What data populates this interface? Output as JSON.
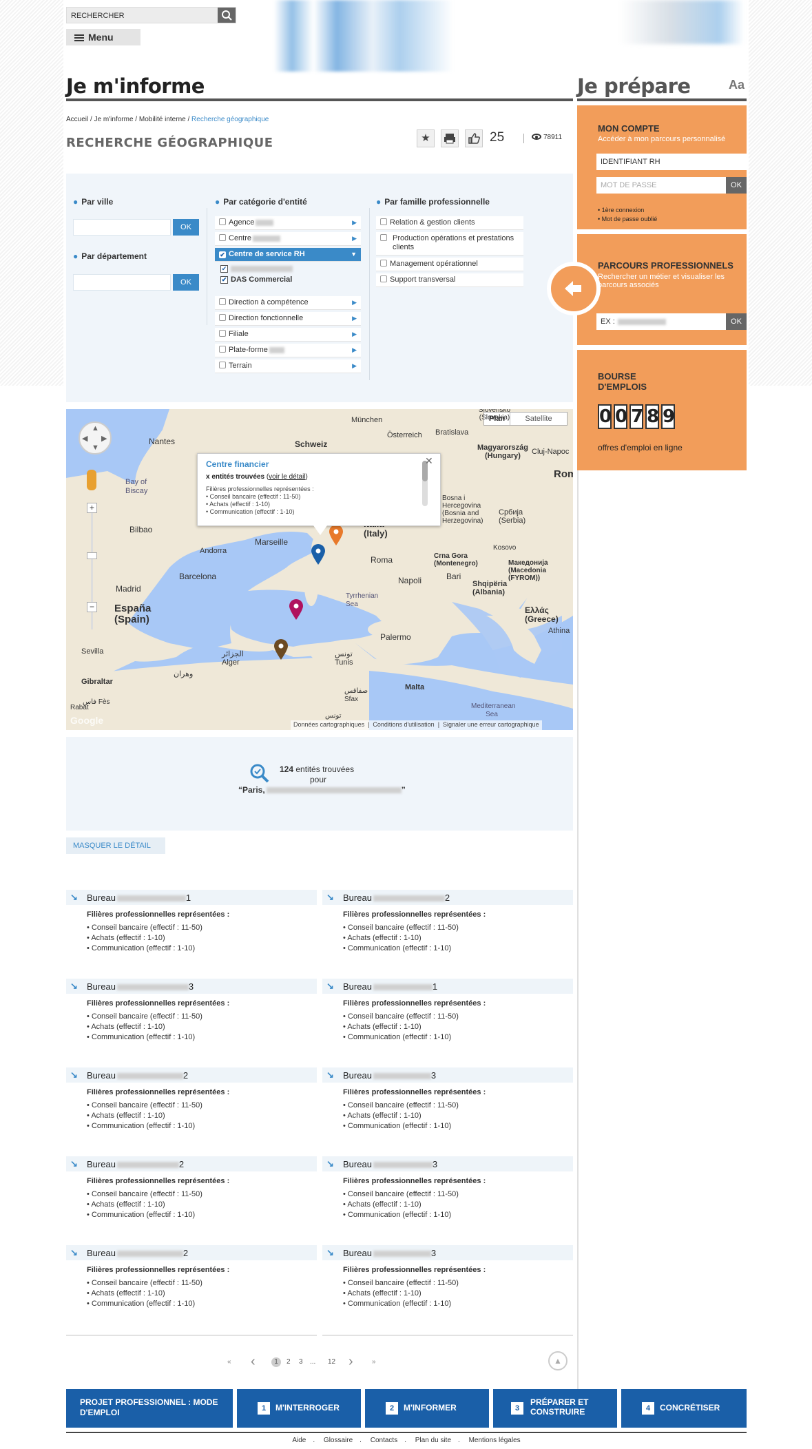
{
  "header": {
    "search_label": "RECHERCHER",
    "menu_label": "Menu",
    "section_left": "Je m'informe",
    "section_right": "Je prépare",
    "font_size_label": "Aa"
  },
  "breadcrumb": {
    "items": [
      "Accueil",
      "Je m'informe",
      "Mobilité interne"
    ],
    "current": "Recherche géographique"
  },
  "page": {
    "title": "RECHERCHE GÉOGRAPHIQUE",
    "likes": "25",
    "views": "78911"
  },
  "filters": {
    "by_city_label": "Par ville",
    "by_department_label": "Par département",
    "ok_label": "OK",
    "by_category_label": "Par catégorie d'entité",
    "categories": [
      {
        "label": "Agence",
        "checked": false
      },
      {
        "label": "Centre",
        "checked": false
      },
      {
        "label": "Centre de service RH",
        "checked": true,
        "selected": true
      },
      {
        "label": "",
        "checked": true
      },
      {
        "label": "DAS Commercial",
        "checked": true
      },
      {
        "label": "Direction à compétence",
        "checked": false
      },
      {
        "label": "Direction fonctionnelle",
        "checked": false
      },
      {
        "label": "Filiale",
        "checked": false
      },
      {
        "label": "Plate-forme",
        "checked": false
      },
      {
        "label": "Terrain",
        "checked": false
      }
    ],
    "by_family_label": "Par famille professionnelle",
    "families": [
      {
        "label": "Relation & gestion clients",
        "checked": false
      },
      {
        "label": "Production opérations et prestations clients",
        "checked": false
      },
      {
        "label": "Management opérationnel",
        "checked": false
      },
      {
        "label": "Support transversal",
        "checked": false
      }
    ]
  },
  "map": {
    "type_plan": "Plan",
    "type_satellite": "Satellite",
    "popup_title": "Centre financier",
    "popup_count": "x entités trouvées",
    "popup_link": "voir le détail",
    "popup_families_label": "Filières professionnelles représentées :",
    "popup_families": [
      "Conseil bancaire (effectif : 11-50)",
      "Achats (effectif : 1-10)",
      "Communication (effectif : 1-10)"
    ],
    "places": [
      "München",
      "Österreich",
      "Bratislava",
      "Slovensko (Slovakia)",
      "Nantes",
      "Schweiz",
      "Magyarország (Hungary)",
      "Cluj-Napoc",
      "Bay of Biscay",
      "Bosna i Hercegovina (Bosnia and Herzegovina)",
      "Србија (Serbia)",
      "Rom",
      "Bilbao",
      "Marseille",
      "Italia (Italy)",
      "Andorra",
      "Barcelona",
      "Roma",
      "Crna Gora (Montenegro)",
      "Kosovo",
      "Madrid",
      "Napoli",
      "Bari",
      "Македонија (Macedonia (FYROM))",
      "España (Spain)",
      "Tyrrhenian Sea",
      "Shqipëria (Albania)",
      "Ελλάς (Greece)",
      "Sevilla",
      "Palermo",
      "Athina",
      "Gibraltar",
      "الجزائر Alger",
      "وهران",
      "تونس Tunis",
      "Malta",
      "صفاقس Sfax",
      "Mediterranean Sea",
      "Rabat",
      "فاس Fès",
      "تونس"
    ],
    "attribution": [
      "Données cartographiques",
      "Conditions d'utilisation",
      "Signaler une erreur cartographique"
    ],
    "google": "Google",
    "pin_colors": [
      "#e8792a",
      "#1a5fa8",
      "#b0125e",
      "#6b4a22"
    ]
  },
  "results": {
    "count": "124",
    "count_suffix": "entités trouvées",
    "for_label": "pour",
    "query": "“Paris,",
    "query_end": "”",
    "toggle_label": "MASQUER LE DÉTAIL",
    "families_label": "Filières professionnelles représentées :",
    "items": [
      {
        "name": "Bureau",
        "suffix": "1",
        "families": [
          "Conseil bancaire (effectif : 11-50)",
          "Achats (effectif : 1-10)",
          "Communication (effectif : 1-10)"
        ]
      },
      {
        "name": "Bureau",
        "suffix": "2",
        "families": [
          "Conseil bancaire (effectif : 11-50)",
          "Achats (effectif : 1-10)",
          "Communication (effectif : 1-10)"
        ]
      },
      {
        "name": "Bureau",
        "suffix": "3",
        "families": [
          "Conseil bancaire (effectif : 11-50)",
          "Achats (effectif : 1-10)",
          "Communication (effectif : 1-10)"
        ]
      },
      {
        "name": "Bureau",
        "suffix": "1",
        "families": [
          "Conseil bancaire (effectif : 11-50)",
          "Achats (effectif : 1-10)",
          "Communication (effectif : 1-10)"
        ]
      },
      {
        "name": "Bureau",
        "suffix": "2",
        "families": [
          "Conseil bancaire (effectif : 11-50)",
          "Achats (effectif : 1-10)",
          "Communication (effectif : 1-10)"
        ]
      },
      {
        "name": "Bureau",
        "suffix": "3",
        "families": [
          "Conseil bancaire (effectif : 11-50)",
          "Achats (effectif : 1-10)",
          "Communication (effectif : 1-10)"
        ]
      },
      {
        "name": "Bureau",
        "suffix": "2",
        "families": [
          "Conseil bancaire (effectif : 11-50)",
          "Achats (effectif : 1-10)",
          "Communication (effectif : 1-10)"
        ]
      },
      {
        "name": "Bureau",
        "suffix": "3",
        "families": [
          "Conseil bancaire (effectif : 11-50)",
          "Achats (effectif : 1-10)",
          "Communication (effectif : 1-10)"
        ]
      },
      {
        "name": "Bureau",
        "suffix": "2",
        "families": [
          "Conseil bancaire (effectif : 11-50)",
          "Achats (effectif : 1-10)",
          "Communication (effectif : 1-10)"
        ]
      },
      {
        "name": "Bureau",
        "suffix": "3",
        "families": [
          "Conseil bancaire (effectif : 11-50)",
          "Achats (effectif : 1-10)",
          "Communication (effectif : 1-10)"
        ]
      }
    ]
  },
  "pagination": {
    "first": "«",
    "prev": "‹",
    "pages": [
      "1",
      "2",
      "3",
      "...",
      "12"
    ],
    "current": "1",
    "next": "›",
    "last": "»"
  },
  "sidebar": {
    "account_title": "MON COMPTE",
    "account_sub": "Accéder à mon parcours personnalisé",
    "id_value": "IDENTIFIANT RH",
    "password_placeholder": "MOT DE PASSE",
    "ok_label": "OK",
    "first_login": "1ère connexion",
    "forgot": "Mot de passe oublié",
    "paths_title": "PARCOURS PROFESSIONNELS",
    "paths_sub": "Rechercher un métier et visualiser les parcours associés",
    "paths_input": "EX :",
    "jobs_title": "BOURSE D'EMPLOIS",
    "jobs_digits": [
      "0",
      "0",
      "7",
      "8",
      "9"
    ],
    "jobs_sub": "offres d'emploi en ligne"
  },
  "footer": {
    "project_label": "PROJET PROFESSIONNEL : MODE D'EMPLOI",
    "steps": [
      {
        "num": "1",
        "label": "M'INTERROGER"
      },
      {
        "num": "2",
        "label": "M'INFORMER"
      },
      {
        "num": "3",
        "label": "PRÉPARER ET CONSTRUIRE"
      },
      {
        "num": "4",
        "label": "CONCRÉTISER"
      }
    ],
    "links": [
      "Aide",
      "Glossaire",
      "Contacts",
      "Plan du site",
      "Mentions légales"
    ]
  },
  "colors": {
    "accent_blue": "#3a8ac8",
    "sidebar_orange": "#f29d5a",
    "footer_blue": "#1a5fa8"
  }
}
